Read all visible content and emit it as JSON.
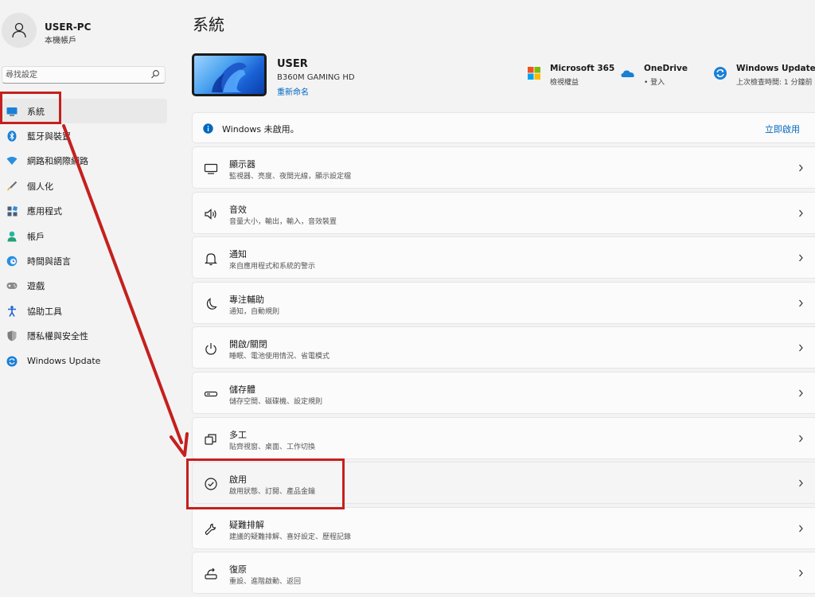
{
  "user": {
    "name": "USER-PC",
    "account_type": "本機帳戶"
  },
  "search": {
    "placeholder": "尋找設定"
  },
  "nav": {
    "items": [
      {
        "label": "系統",
        "icon": "system-icon",
        "active": true
      },
      {
        "label": "藍牙與裝置",
        "icon": "bluetooth-icon"
      },
      {
        "label": "網路和網際網路",
        "icon": "network-icon"
      },
      {
        "label": "個人化",
        "icon": "personalization-brush-icon"
      },
      {
        "label": "應用程式",
        "icon": "apps-icon"
      },
      {
        "label": "帳戶",
        "icon": "accounts-icon"
      },
      {
        "label": "時間與語言",
        "icon": "time-language-icon"
      },
      {
        "label": "遊戲",
        "icon": "gaming-controller-icon"
      },
      {
        "label": "協助工具",
        "icon": "accessibility-icon"
      },
      {
        "label": "隱私權與安全性",
        "icon": "privacy-shield-icon"
      },
      {
        "label": "Windows Update",
        "icon": "windows-update-icon"
      }
    ]
  },
  "page": {
    "title": "系統"
  },
  "device": {
    "name": "USER",
    "model": "B360M GAMING HD",
    "rename_label": "重新命名"
  },
  "quick": {
    "m365": {
      "title": "Microsoft 365",
      "sub": "檢視權益"
    },
    "onedrive": {
      "title": "OneDrive",
      "sub": "• 登入"
    },
    "update": {
      "title": "Windows Update",
      "sub": "上次檢查時間: 1 分鐘前"
    }
  },
  "banner": {
    "text": "Windows 未啟用。",
    "action": "立即啟用"
  },
  "cards": [
    {
      "title": "顯示器",
      "sub": "監視器、亮度、夜間光線，顯示設定檔",
      "icon": "display-icon"
    },
    {
      "title": "音效",
      "sub": "音量大小，輸出，輸入，音效裝置",
      "icon": "sound-icon"
    },
    {
      "title": "通知",
      "sub": "來自應用程式和系統的警示",
      "icon": "notifications-bell-icon"
    },
    {
      "title": "專注輔助",
      "sub": "通知，自動規則",
      "icon": "focus-moon-icon"
    },
    {
      "title": "開啟/關閉",
      "sub": "睡眠、電池使用情況、省電模式",
      "icon": "power-icon"
    },
    {
      "title": "儲存體",
      "sub": "儲存空間、磁碟機、設定規則",
      "icon": "storage-icon"
    },
    {
      "title": "多工",
      "sub": "貼齊視窗、桌面、工作切換",
      "icon": "multitasking-icon"
    },
    {
      "title": "啟用",
      "sub": "啟用狀態、訂閱、產品金鑰",
      "icon": "activation-check-icon",
      "selected": true
    },
    {
      "title": "疑難排解",
      "sub": "建議的疑難排解、喜好設定、歷程記錄",
      "icon": "troubleshoot-wrench-icon"
    },
    {
      "title": "復原",
      "sub": "重設、進階啟動、返回",
      "icon": "recovery-icon"
    }
  ],
  "colors": {
    "accent": "#0067c0",
    "annotation": "#c4201f",
    "background": "#f3f3f3"
  }
}
